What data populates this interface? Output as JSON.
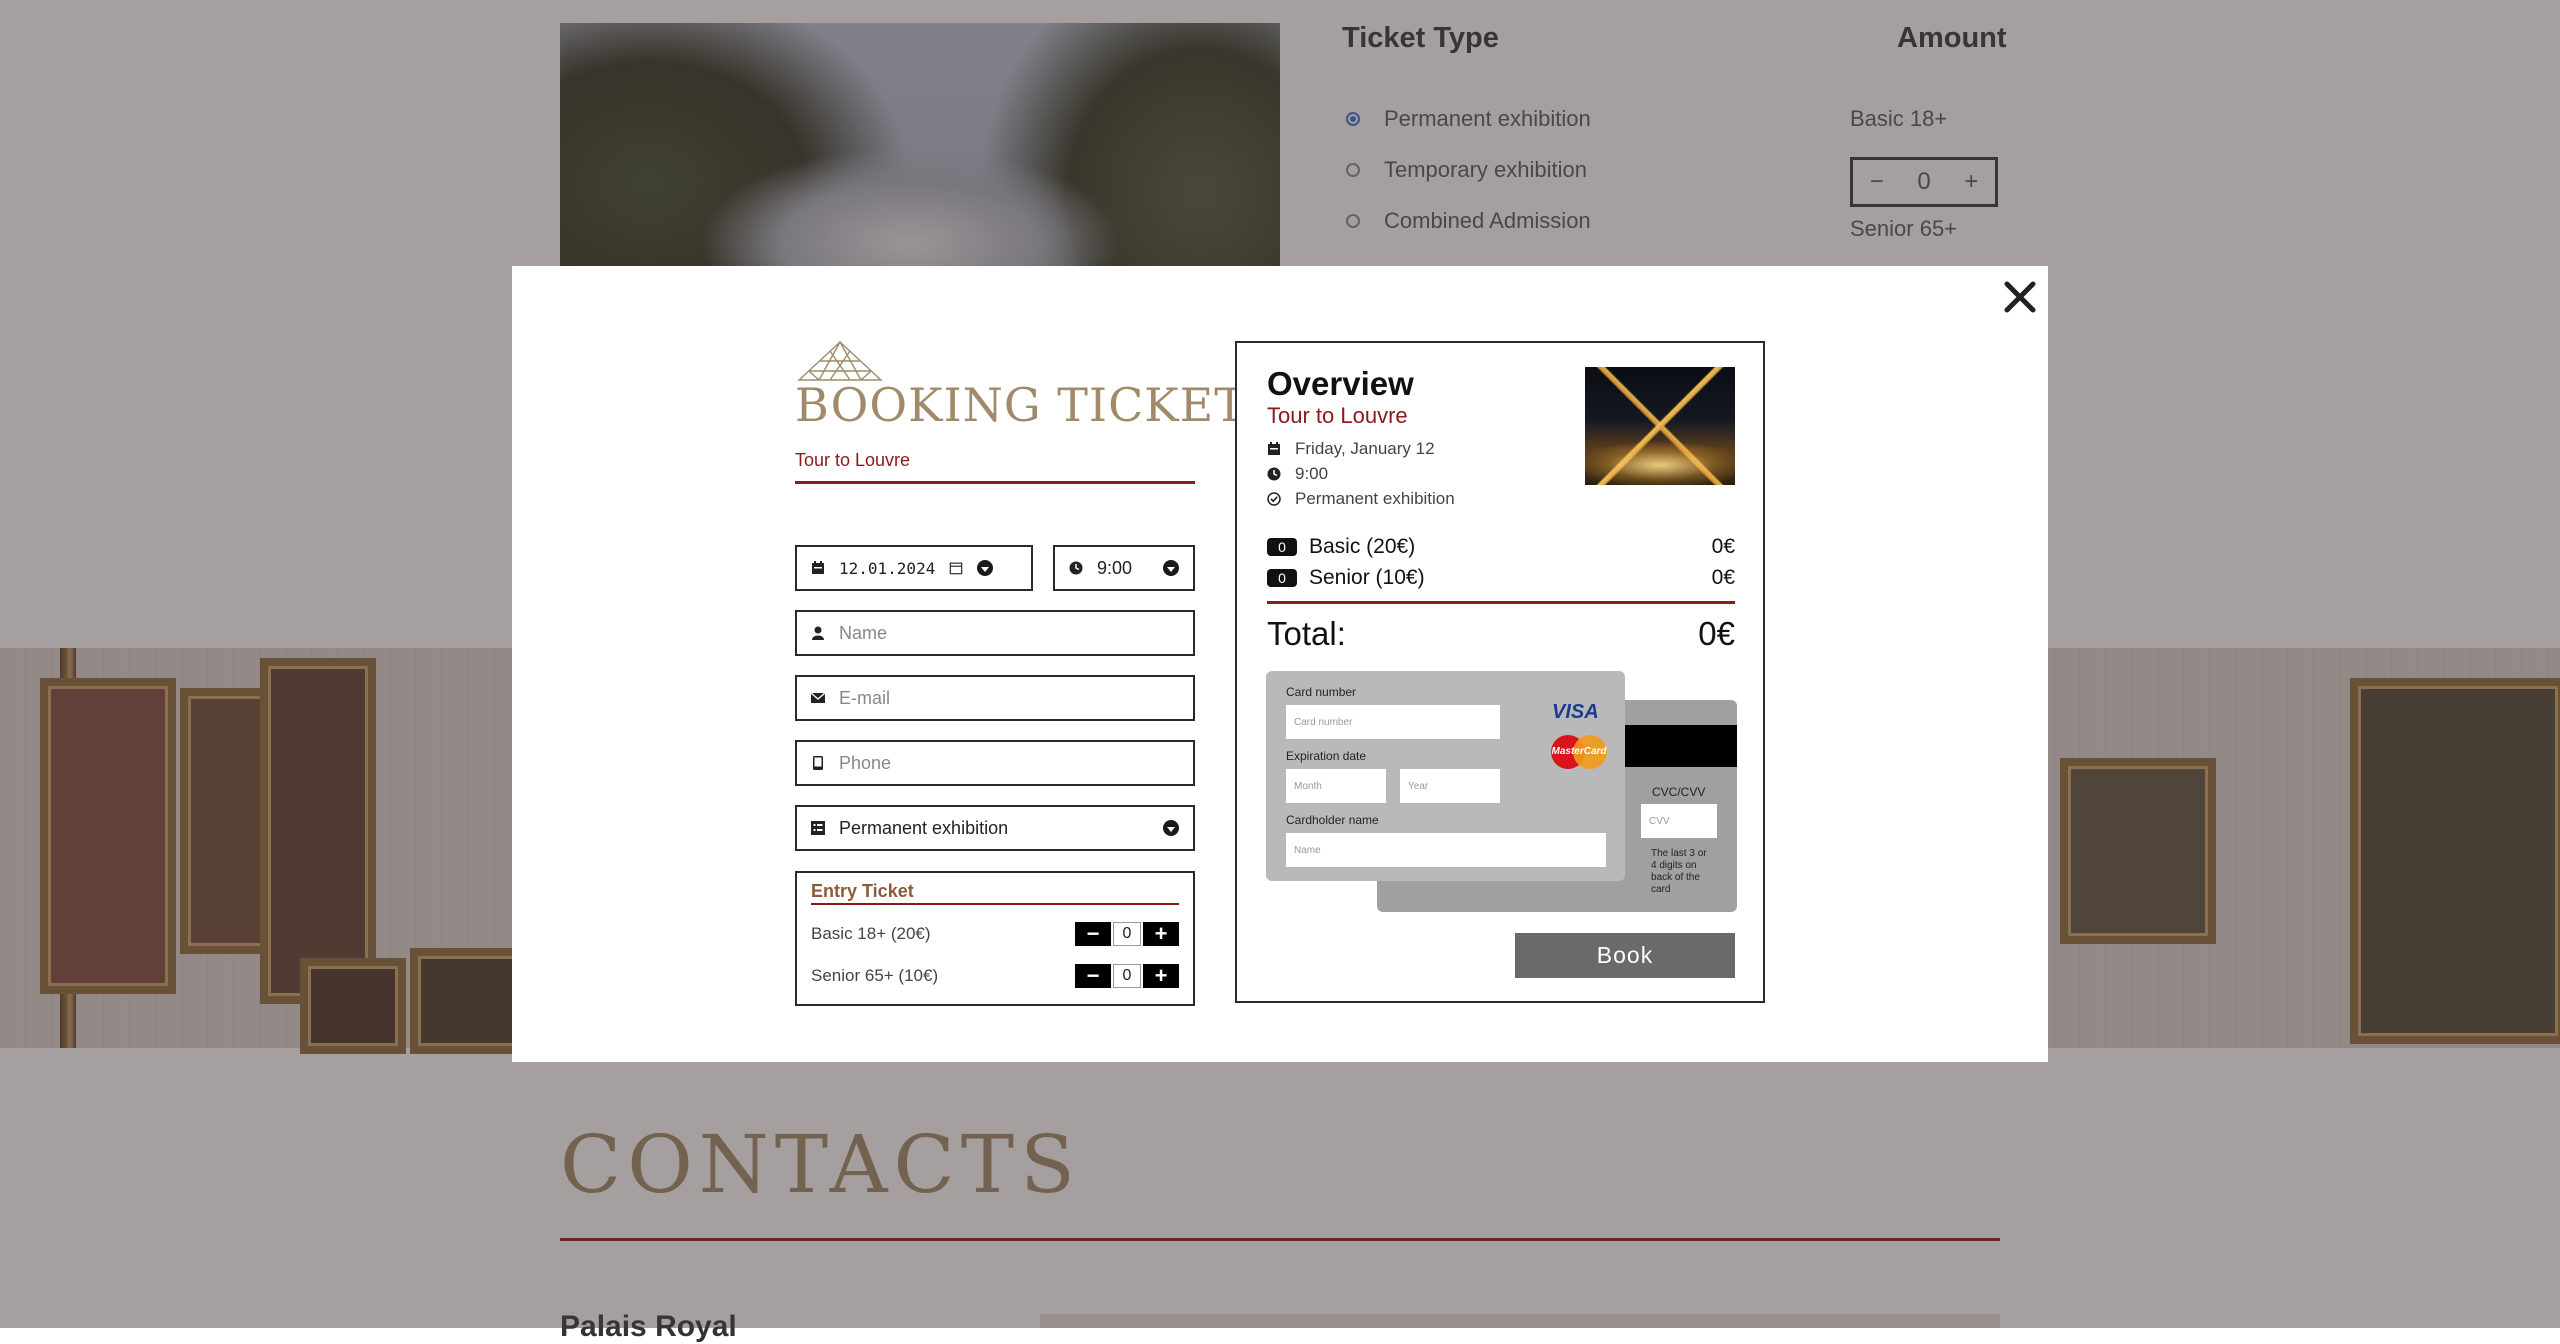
{
  "background": {
    "ticket_type_title": "Ticket Type",
    "amount_title": "Amount",
    "ticket_types": [
      {
        "label": "Permanent exhibition",
        "checked": true
      },
      {
        "label": "Temporary exhibition",
        "checked": false
      },
      {
        "label": "Combined Admission",
        "checked": false
      }
    ],
    "basic_label": "Basic 18+",
    "basic_value": "0",
    "senior_label": "Senior 65+",
    "contacts_title": "CONTACTS",
    "partial_heading": "Palais Royal"
  },
  "modal": {
    "brand_title": "BOOKING TICKETS",
    "brand_subtitle": "Tour to Louvre",
    "date_value": "12.01.2024",
    "time_value": "9:00",
    "name_placeholder": "Name",
    "email_placeholder": "E-mail",
    "phone_placeholder": "Phone",
    "ticket_type_value": "Permanent exhibition",
    "entry": {
      "title": "Entry Ticket",
      "rows": [
        {
          "label": "Basic 18+ (20€)",
          "value": "0"
        },
        {
          "label": "Senior 65+ (10€)",
          "value": "0"
        }
      ]
    },
    "overview": {
      "title": "Overview",
      "subtitle": "Tour to Louvre",
      "date": "Friday, January 12",
      "time": "9:00",
      "type": "Permanent exhibition",
      "items": [
        {
          "count": "0",
          "label": "Basic (20€)",
          "price": "0€"
        },
        {
          "count": "0",
          "label": "Senior (10€)",
          "price": "0€"
        }
      ],
      "total_label": "Total:",
      "total_value": "0€",
      "card": {
        "number_label": "Card number",
        "number_placeholder": "Card number",
        "expiration_label": "Expiration date",
        "month_placeholder": "Month",
        "year_placeholder": "Year",
        "holder_label": "Cardholder name",
        "holder_placeholder": "Name",
        "cvc_label": "CVC/CVV",
        "cvc_placeholder": "CVV",
        "cvc_note": "The last 3 or 4 digits on back of the card",
        "visa": "VISA",
        "mastercard": "MasterCard"
      },
      "book_label": "Book"
    }
  },
  "colors": {
    "accent_red": "#8b1a1a",
    "brand_gold": "#a08a6a",
    "overlay": "rgba(70,55,55,0.48)"
  }
}
